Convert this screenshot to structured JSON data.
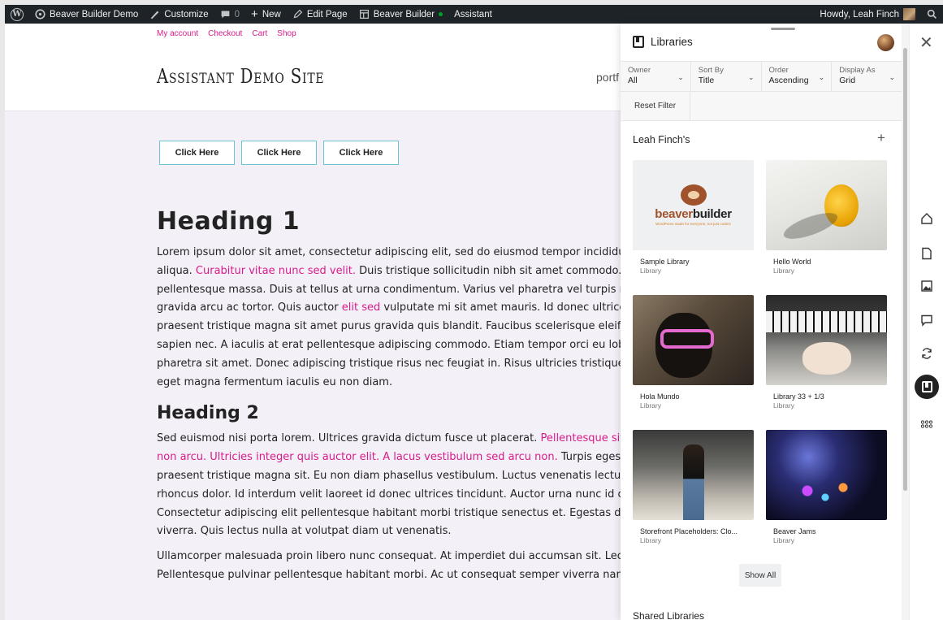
{
  "adminbar": {
    "site_name": "Beaver Builder Demo",
    "customize": "Customize",
    "comments_count": "0",
    "new_label": "New",
    "edit_page": "Edit Page",
    "beaver_builder": "Beaver Builder",
    "assistant": "Assistant",
    "howdy": "Howdy, Leah Finch"
  },
  "site": {
    "nav": [
      "My account",
      "Checkout",
      "Cart",
      "Shop"
    ],
    "title": "Assistant Demo Site",
    "nav_partial": "portf",
    "buttons": [
      "Click Here",
      "Click Here",
      "Click Here"
    ],
    "h1": "Heading 1",
    "p1_lines": [
      {
        "a": "Lorem ipsum dolor sit amet, consectetur adipiscing elit, sed do eiusmod tempor incididu",
        "link": "",
        "b": ""
      },
      {
        "a": "aliqua. ",
        "link": "Curabitur vitae nunc sed velit.",
        "b": " Duis tristique sollicitudin nibh sit amet commodo. I"
      },
      {
        "a": "pellentesque massa. Duis at tellus at urna condimentum. Varius vel pharetra vel turpis n",
        "link": "",
        "b": ""
      },
      {
        "a": "gravida arcu ac tortor. Quis auctor ",
        "link": "elit sed",
        "b": " vulputate mi sit amet mauris. Id donec ultrices"
      },
      {
        "a": "praesent tristique magna sit amet purus gravida quis blandit. Faucibus scelerisque eleife",
        "link": "",
        "b": ""
      },
      {
        "a": "sapien nec. A iaculis at erat pellentesque adipiscing commodo. Etiam tempor orci eu lobo",
        "link": "",
        "b": ""
      },
      {
        "a": "pharetra sit amet. Donec adipiscing tristique risus nec feugiat in. Risus ultricies tristique r",
        "link": "",
        "b": ""
      },
      {
        "a": "eget magna fermentum iaculis eu non diam.",
        "link": "",
        "b": ""
      }
    ],
    "h2": "Heading 2",
    "p2_lines": [
      {
        "a": "Sed euismod nisi porta lorem. Ultrices gravida dictum fusce ut placerat. ",
        "link": "Pellentesque sit",
        "b": ""
      },
      {
        "a": "",
        "link": "non arcu. Ultricies integer quis auctor elit. A lacus vestibulum sed arcu non.",
        "b": " Turpis egesta"
      },
      {
        "a": "praesent tristique magna sit. Eu non diam phasellus vestibulum. Luctus venenatis lectus",
        "link": "",
        "b": ""
      },
      {
        "a": "rhoncus dolor. Id interdum velit laoreet id donec ultrices tincidunt. Auctor urna nunc id c",
        "link": "",
        "b": ""
      },
      {
        "a": "Consectetur adipiscing elit pellentesque habitant morbi tristique senectus et. Egestas dia",
        "link": "",
        "b": ""
      },
      {
        "a": "viverra. Quis lectus nulla at volutpat diam ut venenatis.",
        "link": "",
        "b": ""
      }
    ],
    "p3_lines": [
      {
        "a": "Ullamcorper malesuada proin libero nunc consequat. At imperdiet dui accumsan sit. Lec",
        "link": "",
        "b": ""
      },
      {
        "a": "Pellentesque pulvinar pellentesque habitant morbi. Ac ut consequat semper viverra nam",
        "link": "",
        "b": ""
      }
    ]
  },
  "panel": {
    "title": "Libraries",
    "filters": [
      {
        "label": "Owner",
        "value": "All"
      },
      {
        "label": "Sort By",
        "value": "Title"
      },
      {
        "label": "Order",
        "value": "Ascending"
      },
      {
        "label": "Display As",
        "value": "Grid"
      }
    ],
    "reset_filter": "Reset Filter",
    "section_title": "Leah Finch's",
    "items": [
      {
        "name": "Sample Library",
        "type": "Library",
        "thumb": "beaverbuilder-logo"
      },
      {
        "name": "Hello World",
        "type": "Library",
        "thumb": "pear-photo"
      },
      {
        "name": "Hola Mundo",
        "type": "Library",
        "thumb": "dog-photo"
      },
      {
        "name": "Library 33 + 1/3",
        "type": "Library",
        "thumb": "baby-piano-photo"
      },
      {
        "name": "Storefront Placeholders: Clo...",
        "type": "Library",
        "thumb": "man-photo"
      },
      {
        "name": "Beaver Jams",
        "type": "Library",
        "thumb": "concert-photo"
      }
    ],
    "bb_logo": {
      "part1": "beaver",
      "part2": "builder",
      "tagline": "WordPress made for everyone, not just coders"
    },
    "show_all": "Show All",
    "shared_title": "Shared Libraries"
  },
  "rail": {
    "icons": [
      "home-icon",
      "document-icon",
      "image-icon",
      "comment-icon",
      "refresh-icon",
      "libraries-icon",
      "apps-icon"
    ]
  },
  "colors": {
    "accent_pink": "#d81b8a",
    "adminbar": "#1d2327",
    "button_border": "#6cc3d5"
  }
}
